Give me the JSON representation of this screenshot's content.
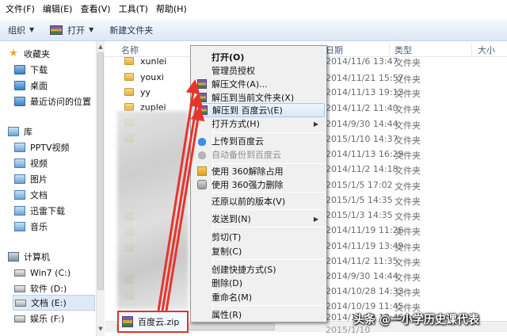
{
  "menubar": [
    "文件(F)",
    "编辑(E)",
    "查看(V)",
    "工具(T)",
    "帮助(H)"
  ],
  "toolbar": {
    "organize": "组织",
    "open": "打开",
    "new_folder": "新建文件夹"
  },
  "sidebar": {
    "favorites": "收藏夹",
    "downloads": "下载",
    "desktop": "桌面",
    "recent": "最近访问的位置",
    "library": "库",
    "pptv": "PPTV视频",
    "videos": "视频",
    "pictures": "图片",
    "documents": "文档",
    "xunlei": "迅雷下载",
    "music": "音乐",
    "computer": "计算机",
    "drive_c": "Win7 (C:)",
    "drive_d": "软件 (D:)",
    "drive_e": "文档 (E:)",
    "drive_f": "娱乐 (F:)"
  },
  "columns": {
    "name": "名称",
    "date": "日期",
    "type": "类型",
    "size": "大小"
  },
  "files": [
    {
      "name": "xunlei",
      "date": "2014/11/6 13:47",
      "type": "文件夹"
    },
    {
      "name": "youxi",
      "date": "2014/11/21 15:57",
      "type": "文件夹"
    },
    {
      "name": "yy",
      "date": "2014/11/13 19:13",
      "type": "文件夹"
    },
    {
      "name": "zuplei",
      "date": "2014/11/2 11:40",
      "type": "文件夹"
    }
  ],
  "more_rows": [
    {
      "date": "2014/9/30 14:44",
      "type": "文件夹"
    },
    {
      "date": "2015/1/10 14:37",
      "type": "文件夹"
    },
    {
      "date": "2014/11/13 16:29",
      "type": "文件夹"
    },
    {
      "date": "2014/11/2 14:18",
      "type": "文件夹"
    },
    {
      "date": "2015/1/5 17:02",
      "type": "文件夹"
    },
    {
      "date": "2015/1/5 14:35",
      "type": "文件夹"
    },
    {
      "date": "2015/1/3 14:35",
      "type": "文件夹"
    },
    {
      "date": "2014/11/19 11:26",
      "type": "文件夹"
    },
    {
      "date": "2014/11/19 13:49",
      "type": "文件夹"
    },
    {
      "date": "2014/11/2 11:35",
      "type": "文件夹"
    },
    {
      "date": "2014/9/30 14:44",
      "type": "文件夹"
    },
    {
      "date": "2014/10/28 14:33",
      "type": "文件夹"
    },
    {
      "date": "2014/10/19 11:45",
      "type": "文件夹"
    },
    {
      "date": "2014/11/19 13:46",
      "type": "文件夹"
    }
  ],
  "zip_file": {
    "name": "百度云.zip",
    "date": "2015/1/10"
  },
  "context_menu": {
    "open": "打开(O)",
    "admin": "管理员授权",
    "extract_files": "解压文件(A)...",
    "extract_here": "解压到当前文件夹(X)",
    "extract_to": "解压到 百度云\\(E)",
    "open_with": "打开方式(H)",
    "upload_baidu": "上传到百度云",
    "auto_backup": "自动备份到百度云",
    "unlock_360": "使用 360解除占用",
    "force_delete_360": "使用 360强力删除",
    "restore_version": "还原以前的版本(V)",
    "send_to": "发送到(N)",
    "cut": "剪切(T)",
    "copy": "复制(C)",
    "create_shortcut": "创建快捷方式(S)",
    "delete": "删除(D)",
    "rename": "重命名(M)",
    "properties": "属性(R)"
  },
  "watermark": "头条 @一小学历史课代表",
  "colors": {
    "highlight_red": "#d9362f",
    "menu_hover": "#dce8f8"
  }
}
